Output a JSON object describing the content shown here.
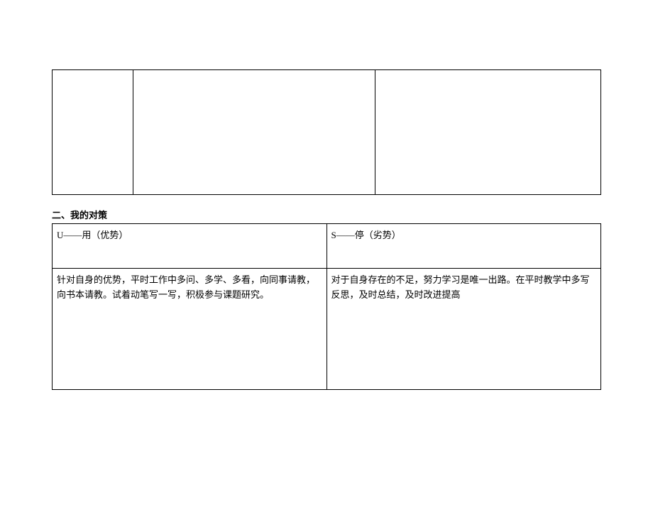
{
  "section2": {
    "heading": "二、我的对策",
    "headers": {
      "left": "U——用（优势）",
      "right": "S——停（劣势）"
    },
    "content": {
      "left": "针对自身的优势，平时工作中多问、多学、多看，向同事请教，向书本请教。试着动笔写一写，积极参与课题研究。",
      "right": "对于自身存在的不足，努力学习是唯一出路。在平时教学中多写反思，及时总结，及时改进提高"
    }
  }
}
